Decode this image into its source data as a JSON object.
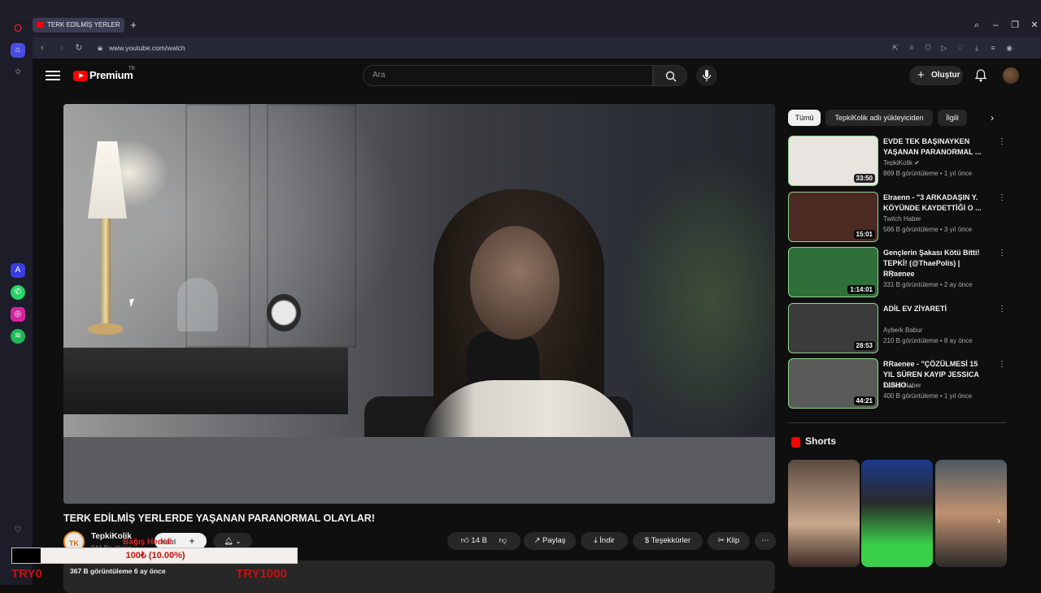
{
  "browser": {
    "tab_title": "TERK EDİLMİŞ YERLER",
    "new_tab": "+",
    "url": "www.youtube.com/watch"
  },
  "youtube": {
    "logo": "Premium",
    "logo_region": "TR",
    "search_placeholder": "Ara",
    "create_label": "Oluştur"
  },
  "video": {
    "title": "TERK EDİLMİŞ YERLERDE YAŞANAN PARANORMAL OLAYLAR!",
    "channel_avatar_text": "TK",
    "channel": "TepkiKolik",
    "subscribers": "944 Bn abone",
    "join_label": "Katıl",
    "likes": "14 B",
    "share": "Paylaş",
    "download": "İndir",
    "thanks": "Teşekkürler",
    "clip": "Klip",
    "more": "⋯",
    "views_line": "367 B görüntüleme  6 ay önce"
  },
  "overlay": {
    "goal_label": "Bağış Hedefi",
    "progress_text": "100₺ (10.00%)",
    "progress_fraction": 0.1,
    "min": "TRY0",
    "max": "TRY1000"
  },
  "chips": [
    "Tümü",
    "TepkiKolik adlı yükleyiciden",
    "İlgili"
  ],
  "recommendations": [
    {
      "title": "EVDE TEK BAŞINAYKEN YAŞANAN PARANORMAL ...",
      "channel": "TepkiKolik ✔",
      "meta": "869 B görüntüleme • 1 yıl önce",
      "duration": "33:50",
      "color": "#e8e4e0"
    },
    {
      "title": "Elraenn - \"3 ARKADAŞIN Y. KÖYÜNDE KAYDETTİĞİ O ...",
      "channel": "Twitch Haber",
      "meta": "566 B görüntüleme • 3 yıl önce",
      "duration": "15:01",
      "color": "#4a2a22"
    },
    {
      "title": "Gençlerin Şakası Kötü Bitti! TEPKİ! (@ThaePolis) | RRaenee",
      "channel": "cFyt ✔",
      "meta": "331 B görüntüleme • 2 ay önce",
      "duration": "1:14:01",
      "color": "#2f6f3a"
    },
    {
      "title": "ADİL EV ZİYARETİ",
      "channel": "Ayberk Babur",
      "meta": "210 B görüntüleme • 8 ay önce",
      "duration": "28:53",
      "color": "#3b3b3b"
    },
    {
      "title": "RRaenee - \"ÇÖZÜLMESİ 15 YIL SÜREN KAYIP JESSICA DISHO...",
      "channel": "Twitch Haber",
      "meta": "400 B görüntüleme • 1 yıl önce",
      "duration": "44:21",
      "color": "#5a5a58"
    }
  ],
  "shorts_title": "Shorts",
  "cursor_visible": true
}
